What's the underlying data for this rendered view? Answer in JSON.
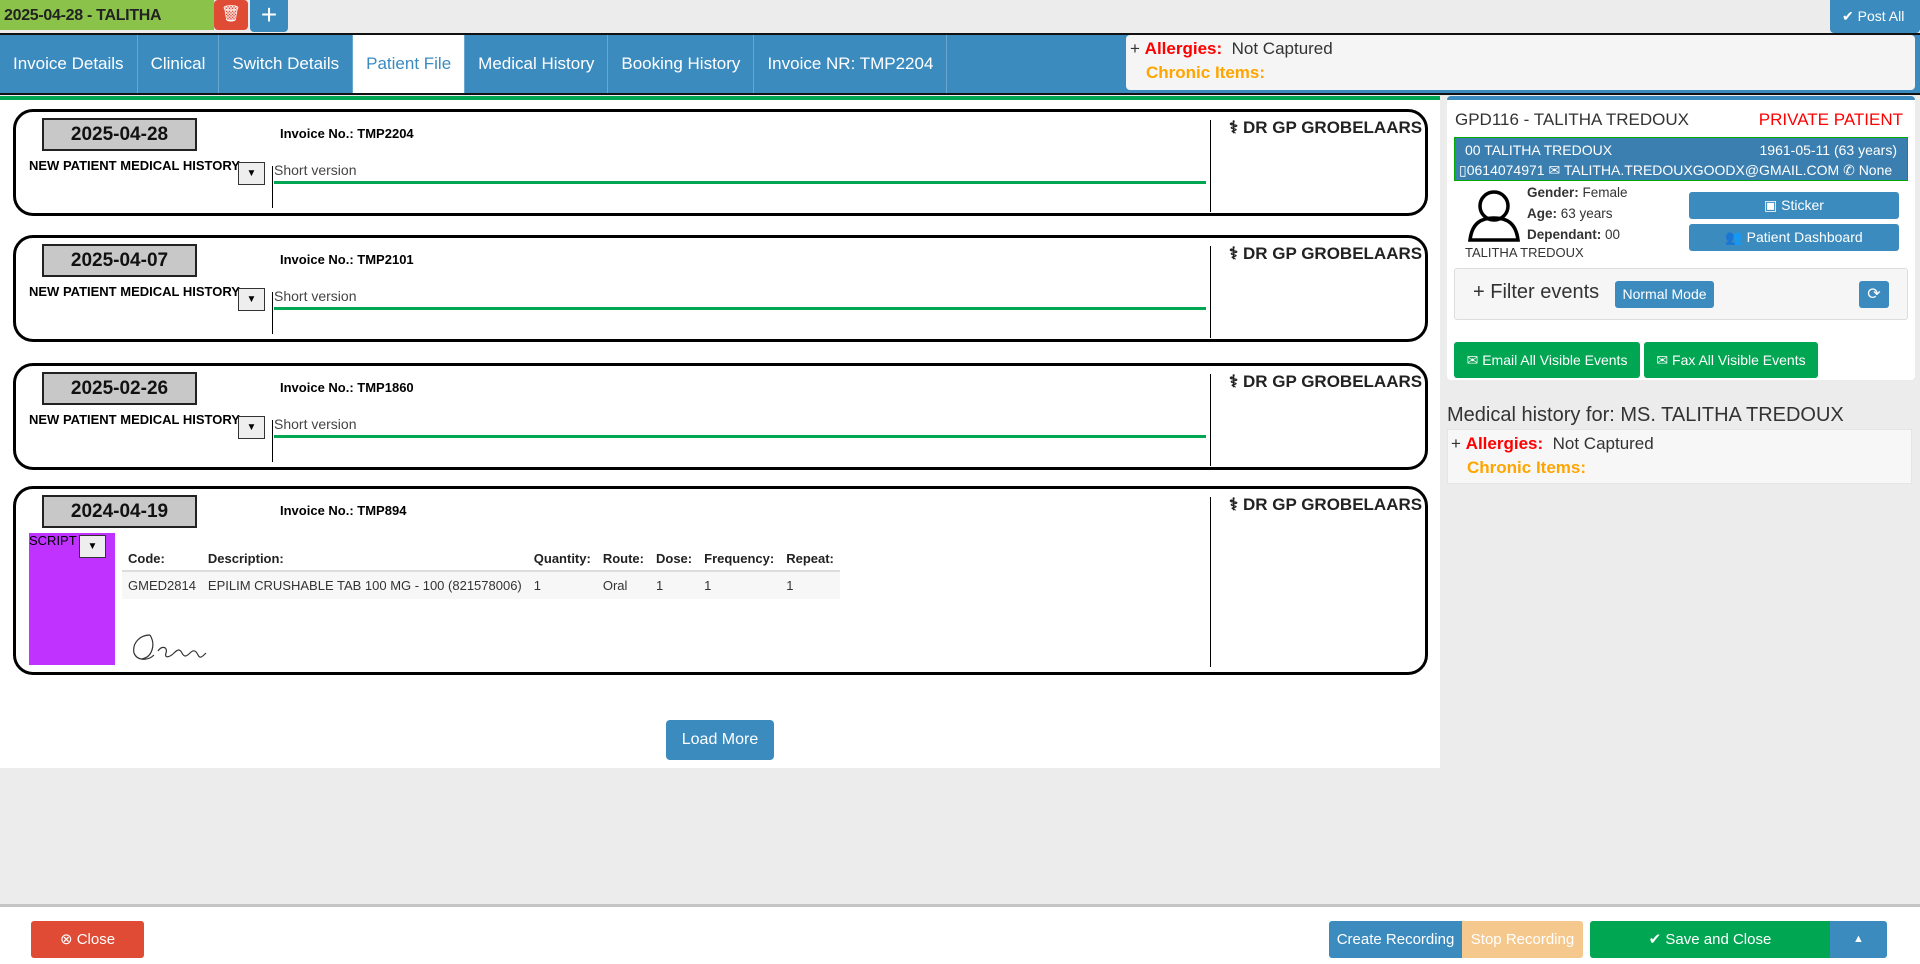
{
  "header": {
    "title": "2025-04-28 - TALITHA",
    "post_all": "Post All"
  },
  "tabs": [
    "Invoice Details",
    "Clinical",
    "Switch Details",
    "Patient File",
    "Medical History",
    "Booking History",
    "Invoice NR: TMP2204"
  ],
  "active_tab": 3,
  "allergy_summary": {
    "plus": "+",
    "allergies_label": "Allergies:",
    "allergies_value": "Not Captured",
    "chronic_label": "Chronic Items:"
  },
  "events": [
    {
      "date": "2025-04-28",
      "invoice": "Invoice No.: TMP2204",
      "type": "NEW PATIENT MEDICAL HISTORY",
      "note": "Short version",
      "doctor": "DR GP GROBELAARS"
    },
    {
      "date": "2025-04-07",
      "invoice": "Invoice No.: TMP2101",
      "type": "NEW PATIENT MEDICAL HISTORY",
      "note": "Short version",
      "doctor": "DR GP GROBELAARS"
    },
    {
      "date": "2025-02-26",
      "invoice": "Invoice No.: TMP1860",
      "type": "NEW PATIENT MEDICAL HISTORY",
      "note": "Short version",
      "doctor": "DR GP GROBELAARS"
    }
  ],
  "script_event": {
    "date": "2024-04-19",
    "invoice": "Invoice No.: TMP894",
    "type": "SCRIPT",
    "doctor": "DR GP GROBELAARS",
    "headers": [
      "Code:",
      "Description:",
      "Quantity:",
      "Route:",
      "Dose:",
      "Frequency:",
      "Repeat:"
    ],
    "rows": [
      [
        "GMED2814",
        "EPILIM CRUSHABLE TAB 100 MG - 100 (821578006)",
        "1",
        "Oral",
        "1",
        "1",
        "1"
      ]
    ]
  },
  "load_more": "Load More",
  "patient": {
    "title": "GPD116 - TALITHA TREDOUX",
    "category": "PRIVATE PATIENT",
    "name_line": "00 TALITHA TREDOUX",
    "dob": "1961-05-11 (63 years)",
    "phone": "0614074971",
    "email": "TALITHA.TREDOUXGOODX@GMAIL.COM",
    "tel": "None",
    "gender_label": "Gender:",
    "gender": "Female",
    "age_label": "Age:",
    "age": "63 years",
    "dependant_label": "Dependant:",
    "dependant": "00",
    "avatar_name": "TALITHA TREDOUX",
    "sticker": "Sticker",
    "dashboard": "Patient Dashboard",
    "filter": "+ Filter events",
    "mode": "Normal Mode",
    "email_all": "Email All Visible Events",
    "fax_all": "Fax All Visible Events"
  },
  "medical_history": {
    "title": "Medical history for: MS. TALITHA TREDOUX",
    "plus": "+",
    "allergies_label": "Allergies:",
    "allergies_value": "Not Captured",
    "chronic_label": "Chronic Items:"
  },
  "footer": {
    "close": "Close",
    "create_recording": "Create Recording",
    "stop_recording": "Stop Recording",
    "save_close": "Save and Close"
  }
}
